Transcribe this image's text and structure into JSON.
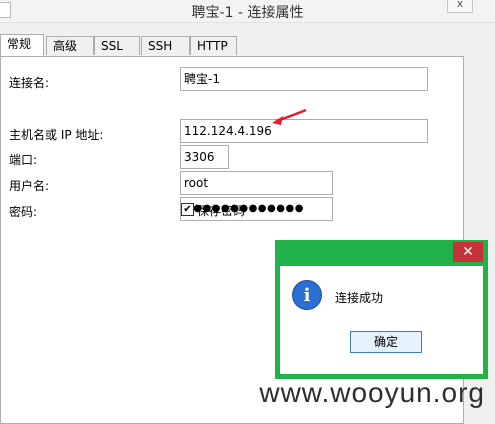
{
  "window": {
    "title": "聘宝-1 - 连接属性",
    "close_label": "x"
  },
  "tabs": [
    {
      "label": "常规",
      "active": true
    },
    {
      "label": "高级"
    },
    {
      "label": "SSL"
    },
    {
      "label": "SSH"
    },
    {
      "label": "HTTP"
    }
  ],
  "form": {
    "connection_name_label": "连接名:",
    "connection_name_value": "聘宝-1",
    "host_label": "主机名或 IP 地址:",
    "host_value": "112.124.4.196",
    "port_label": "端口:",
    "port_value": "3306",
    "username_label": "用户名:",
    "username_value": "root",
    "password_label": "密码:",
    "password_value": "●●●●●●●●●●●●●",
    "save_password_label": "保存密码",
    "save_password_checked": "✔"
  },
  "dialog": {
    "close_label": "✕",
    "icon": "info-icon",
    "message": "连接成功",
    "ok_label": "确定"
  },
  "watermark": "www.wooyun.org",
  "colors": {
    "dialog_frame": "#21b24a",
    "dialog_close": "#c8313a",
    "annotation_arrow": "#e8192c"
  }
}
